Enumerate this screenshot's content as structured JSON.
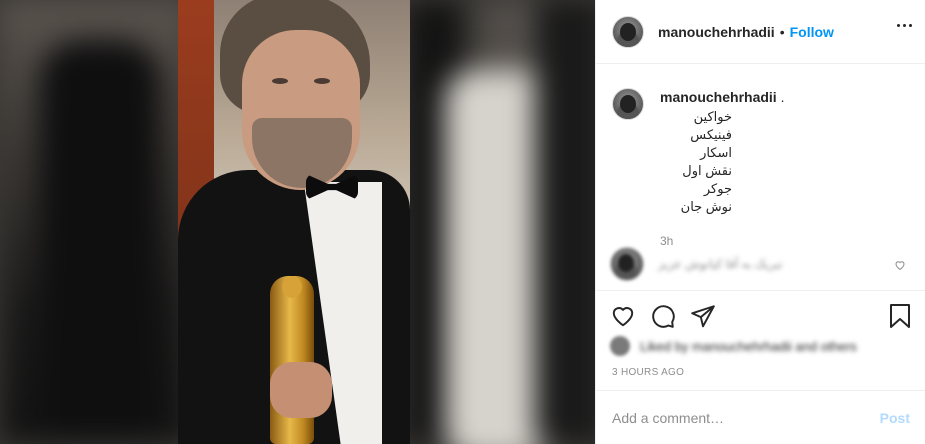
{
  "header": {
    "username": "manouchehrhadii",
    "separator": "•",
    "follow_label": "Follow"
  },
  "caption": {
    "username": "manouchehrhadii",
    "suffix": ".",
    "lines": [
      "خواکین فینیکس",
      "اسکار",
      "نقش اول",
      "جوکر",
      "نوش جان"
    ],
    "time": "3h"
  },
  "comment": {
    "text": "تبریک به آقا کیانوش عزیز"
  },
  "likes": {
    "text": "Liked by manouchehrhadii and others"
  },
  "post_time": "3 HOURS AGO",
  "add_comment": {
    "placeholder": "Add a comment…",
    "post_label": "Post"
  },
  "icons": {
    "more": "more-horizontal-icon",
    "like": "heart-outline-icon",
    "comment": "comment-bubble-icon",
    "share": "paper-plane-icon",
    "save": "bookmark-icon",
    "comment_like": "small-heart-icon"
  }
}
